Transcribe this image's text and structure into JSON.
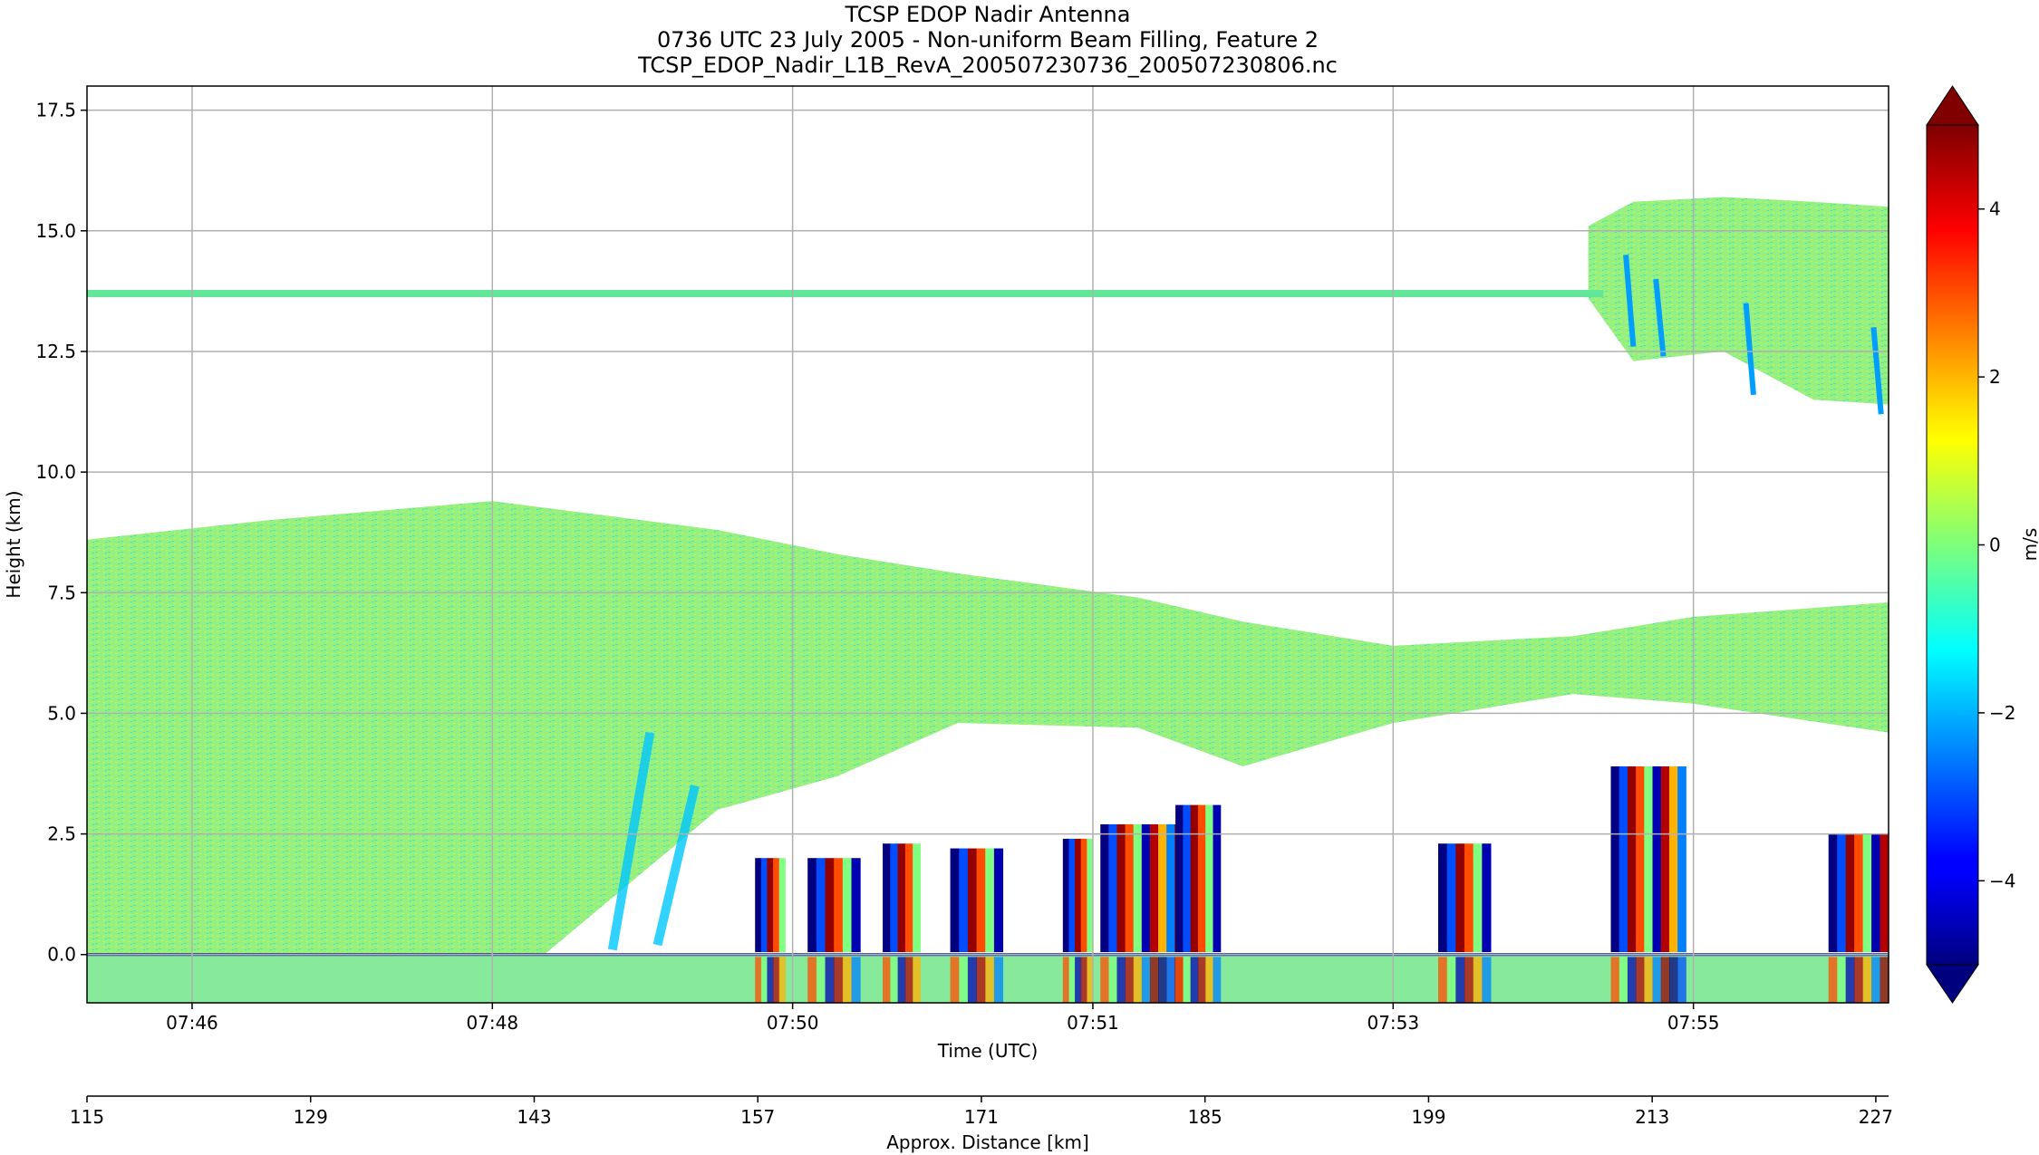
{
  "chart_data": {
    "type": "heatmap",
    "title_lines": [
      "TCSP EDOP Nadir Antenna",
      "0736 UTC 23 July 2005 - Non-uniform Beam Filling, Feature 2",
      "TCSP_EDOP_Nadir_L1B_RevA_200507230736_200507230806.nc"
    ],
    "xlabel": "Time (UTC)",
    "ylabel": "Height (km)",
    "x2label": "Approx. Distance [km]",
    "colorbar_label": "m/s",
    "colormap": "jet",
    "clim": [
      -5,
      5
    ],
    "colorbar_extend": "both",
    "grid": true,
    "xlim_minutes": [
      45.3,
      57.3
    ],
    "ylim": [
      -1.0,
      18.0
    ],
    "xticks": [
      {
        "label": "07:46",
        "minutes": 46
      },
      {
        "label": "07:48",
        "minutes": 48
      },
      {
        "label": "07:50",
        "minutes": 50
      },
      {
        "label": "07:51",
        "minutes": 52
      },
      {
        "label": "07:53",
        "minutes": 54
      },
      {
        "label": "07:55",
        "minutes": 56
      }
    ],
    "yticks": [
      {
        "label": "0.0",
        "value": 0.0
      },
      {
        "label": "2.5",
        "value": 2.5
      },
      {
        "label": "5.0",
        "value": 5.0
      },
      {
        "label": "7.5",
        "value": 7.5
      },
      {
        "label": "10.0",
        "value": 10.0
      },
      {
        "label": "12.5",
        "value": 12.5
      },
      {
        "label": "15.0",
        "value": 15.0
      },
      {
        "label": "17.5",
        "value": 17.5
      }
    ],
    "x2lim": [
      115,
      227.8
    ],
    "x2ticks": [
      {
        "label": "115",
        "value": 115
      },
      {
        "label": "129",
        "value": 129
      },
      {
        "label": "143",
        "value": 143
      },
      {
        "label": "157",
        "value": 157
      },
      {
        "label": "171",
        "value": 171
      },
      {
        "label": "185",
        "value": 185
      },
      {
        "label": "199",
        "value": 199
      },
      {
        "label": "213",
        "value": 213
      },
      {
        "label": "227",
        "value": 227
      }
    ],
    "cbar_ticks": [
      {
        "label": "−4",
        "value": -4
      },
      {
        "label": "−2",
        "value": -2
      },
      {
        "label": "0",
        "value": 0
      },
      {
        "label": "2",
        "value": 2
      },
      {
        "label": "4",
        "value": 4
      }
    ],
    "features": {
      "surface_height_km": 0.0,
      "bright_band_height_km": 13.7,
      "stratiform_layer": [
        {
          "t": 45.3,
          "bottom": -0.9,
          "top": 8.6
        },
        {
          "t": 46.5,
          "bottom": -0.9,
          "top": 9.0
        },
        {
          "t": 48.0,
          "bottom": -0.9,
          "top": 9.4
        },
        {
          "t": 49.5,
          "bottom": 3.0,
          "top": 8.8
        },
        {
          "t": 50.3,
          "bottom": 3.7,
          "top": 8.3
        },
        {
          "t": 51.1,
          "bottom": 4.8,
          "top": 7.9
        },
        {
          "t": 52.3,
          "bottom": 4.7,
          "top": 7.4
        },
        {
          "t": 53.0,
          "bottom": 3.9,
          "top": 6.9
        },
        {
          "t": 54.0,
          "bottom": 4.8,
          "top": 6.4
        },
        {
          "t": 55.2,
          "bottom": 5.4,
          "top": 6.6
        },
        {
          "t": 56.0,
          "bottom": 5.2,
          "top": 7.0
        },
        {
          "t": 57.3,
          "bottom": 4.6,
          "top": 7.3
        }
      ],
      "upper_anvil": [
        {
          "t": 55.3,
          "bottom": 13.6,
          "top": 15.1
        },
        {
          "t": 55.6,
          "bottom": 12.3,
          "top": 15.6
        },
        {
          "t": 56.2,
          "bottom": 12.5,
          "top": 15.7
        },
        {
          "t": 56.8,
          "bottom": 11.5,
          "top": 15.6
        },
        {
          "t": 57.3,
          "bottom": 11.4,
          "top": 15.5
        }
      ],
      "convective_cells": [
        {
          "t_start": 49.75,
          "t_end": 49.95,
          "top_km": 2.0
        },
        {
          "t_start": 50.1,
          "t_end": 50.45,
          "top_km": 2.0
        },
        {
          "t_start": 50.6,
          "t_end": 50.85,
          "top_km": 2.3
        },
        {
          "t_start": 51.05,
          "t_end": 51.4,
          "top_km": 2.2
        },
        {
          "t_start": 51.8,
          "t_end": 52.0,
          "top_km": 2.4
        },
        {
          "t_start": 52.05,
          "t_end": 52.6,
          "top_km": 2.7
        },
        {
          "t_start": 52.55,
          "t_end": 52.85,
          "top_km": 3.1
        },
        {
          "t_start": 54.3,
          "t_end": 54.65,
          "top_km": 2.3
        },
        {
          "t_start": 55.45,
          "t_end": 55.95,
          "top_km": 3.9
        },
        {
          "t_start": 56.9,
          "t_end": 57.3,
          "top_km": 2.5
        }
      ]
    }
  }
}
